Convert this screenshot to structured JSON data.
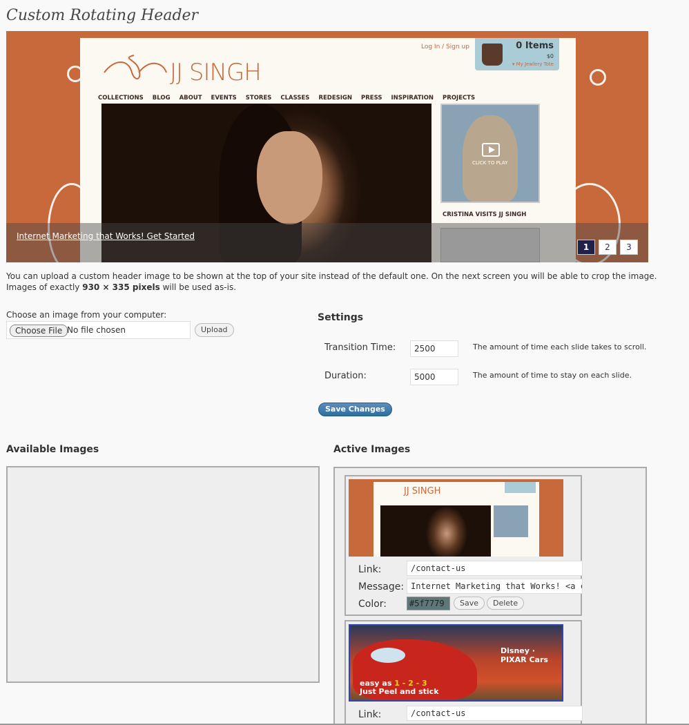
{
  "page": {
    "title": "Custom Rotating Header"
  },
  "preview": {
    "site_logo": "JJ SINGH",
    "login_link": "Log In / Sign up",
    "cart": {
      "items": "0 Items",
      "amount": "$0",
      "tote": "▾ My Jewlery Tote"
    },
    "nav": [
      "COLLECTIONS",
      "BLOG",
      "ABOUT",
      "EVENTS",
      "STORES",
      "CLASSES",
      "REDESIGN",
      "PRESS",
      "INSPIRATION",
      "PROJECTS"
    ],
    "video_label": "CLICK TO PLAY",
    "side_caption": "CRISTINA VISITS JJ SINGH",
    "message_link": "Internet Marketing that Works! Get Started",
    "pager": [
      "1",
      "2",
      "3"
    ],
    "pager_active": "1"
  },
  "upload": {
    "intro_line1": "You can upload a custom header image to be shown at the top of your site instead of the default one. On the next screen you will be able to crop the image.",
    "intro_line2_pre": "Images of exactly ",
    "intro_line2_bold": "930 × 335 pixels",
    "intro_line2_post": " will be used as-is.",
    "choose_label": "Choose an image from your computer:",
    "choose_button": "Choose File",
    "file_status": "No file chosen",
    "upload_button": "Upload"
  },
  "settings": {
    "title": "Settings",
    "transition_label": "Transition Time:",
    "transition_value": "2500",
    "transition_help": "The amount of time each slide takes to scroll.",
    "duration_label": "Duration:",
    "duration_value": "5000",
    "duration_help": "The amount of time to stay on each slide.",
    "save_button": "Save Changes"
  },
  "images": {
    "available_title": "Available Images",
    "active_title": "Active Images",
    "active": [
      {
        "link_label": "Link:",
        "link_value": "/contact-us",
        "message_label": "Message:",
        "message_value": "Internet Marketing that Works! <a class='",
        "color_label": "Color:",
        "color_value": "#5f7779",
        "save_button": "Save",
        "delete_button": "Delete",
        "thumb_logo": "JJ SINGH"
      },
      {
        "link_label": "Link:",
        "link_value": "/contact-us",
        "thumb_brand": "Disney · PIXAR Cars",
        "thumb_tagline_1": "easy as ",
        "thumb_tagline_nums": "1 - 2 - 3",
        "thumb_tagline_2": "Just Peel and stick"
      }
    ]
  },
  "colors": {
    "accent": "#c8693c",
    "primary_button": "#2e6d9c",
    "pager_active": "#20204a"
  }
}
